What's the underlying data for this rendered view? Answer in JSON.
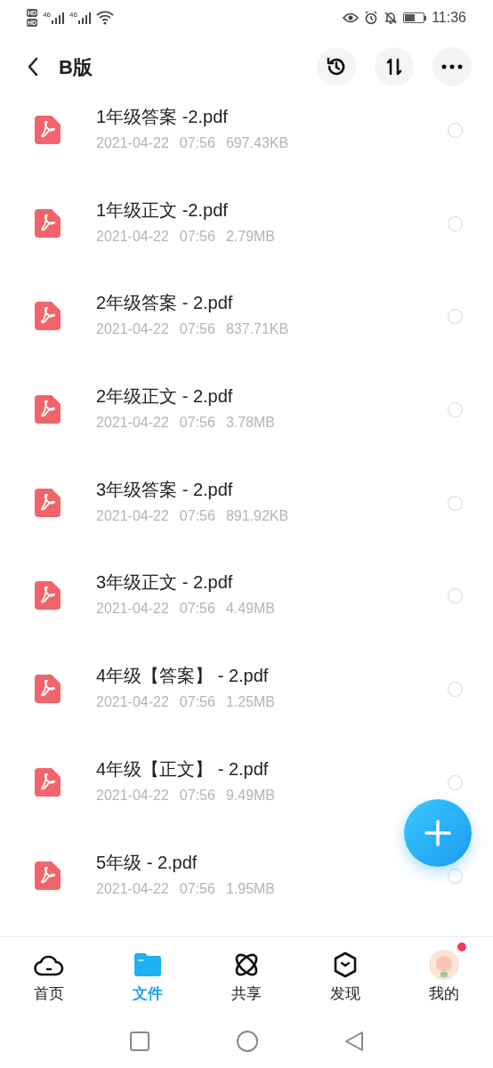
{
  "status_bar": {
    "sim_labels": [
      "HD",
      "HD"
    ],
    "networks": [
      "46",
      "46"
    ],
    "time": "11:36",
    "battery": {
      "level": 0.55
    }
  },
  "header": {
    "title": "B版"
  },
  "files": [
    {
      "name": "1年级答案 -2.pdf",
      "date": "2021-04-22",
      "time": "07:56",
      "size": "697.43KB",
      "selected": false
    },
    {
      "name": "1年级正文 -2.pdf",
      "date": "2021-04-22",
      "time": "07:56",
      "size": "2.79MB",
      "selected": false
    },
    {
      "name": "2年级答案 - 2.pdf",
      "date": "2021-04-22",
      "time": "07:56",
      "size": "837.71KB",
      "selected": false
    },
    {
      "name": "2年级正文 - 2.pdf",
      "date": "2021-04-22",
      "time": "07:56",
      "size": "3.78MB",
      "selected": false
    },
    {
      "name": "3年级答案 - 2.pdf",
      "date": "2021-04-22",
      "time": "07:56",
      "size": "891.92KB",
      "selected": false
    },
    {
      "name": "3年级正文 - 2.pdf",
      "date": "2021-04-22",
      "time": "07:56",
      "size": "4.49MB",
      "selected": false
    },
    {
      "name": "4年级【答案】 - 2.pdf",
      "date": "2021-04-22",
      "time": "07:56",
      "size": "1.25MB",
      "selected": false
    },
    {
      "name": "4年级【正文】 - 2.pdf",
      "date": "2021-04-22",
      "time": "07:56",
      "size": "9.49MB",
      "selected": false
    },
    {
      "name": "5年级 - 2.pdf",
      "date": "2021-04-22",
      "time": "07:56",
      "size": "1.95MB",
      "selected": false
    }
  ],
  "tabs": [
    {
      "label": "首页",
      "kind": "cloud",
      "selected": false,
      "badge": false
    },
    {
      "label": "文件",
      "kind": "folder",
      "selected": true,
      "badge": false
    },
    {
      "label": "共享",
      "kind": "orbit",
      "selected": false,
      "badge": false
    },
    {
      "label": "发现",
      "kind": "hexagon",
      "selected": false,
      "badge": false
    },
    {
      "label": "我的",
      "kind": "avatar",
      "selected": false,
      "badge": true
    }
  ]
}
